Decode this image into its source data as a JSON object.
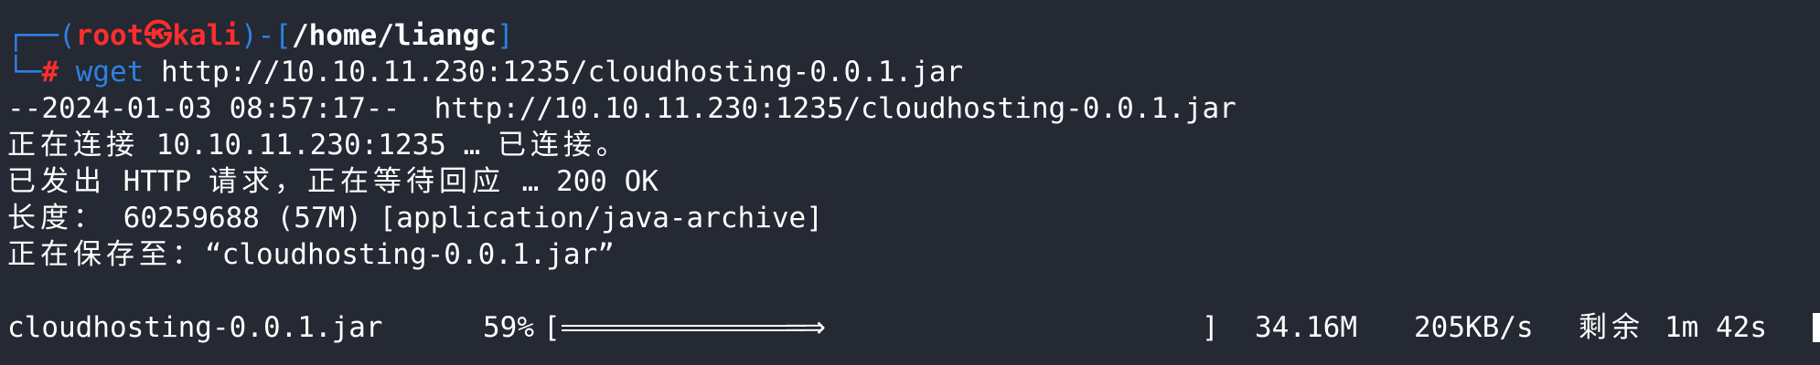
{
  "prompt": {
    "corner_top": "┌──(",
    "user": "root",
    "skull_glyph": "㉿",
    "host": "kali",
    "close_open": ")-[",
    "path": "/home/liangc",
    "close_bracket": "]",
    "corner_bottom": "└─",
    "hash": "#"
  },
  "command": {
    "name": "wget",
    "argument": "http://10.10.11.230:1235/cloudhosting-0.0.1.jar"
  },
  "output": {
    "line1": "--2024-01-03 08:57:17--  http://10.10.11.230:1235/cloudhosting-0.0.1.jar",
    "line2_cjk": "正在连接",
    "line2_rest": " 10.10.11.230:1235 … ",
    "line2_cjk2": "已连接。",
    "line3_cjk": "已发出",
    "line3_mid": " HTTP ",
    "line3_cjk2": "请求，正在等待回应",
    "line3_rest": " … 200 OK",
    "line4_cjk": "长度：",
    "line4_rest": " 60259688 (57M) [application/java-archive]",
    "line5_cjk": "正在保存至：",
    "line5_rest": "“cloudhosting-0.0.1.jar”"
  },
  "progress": {
    "filename": "cloudhosting-0.0.1.jar",
    "percent_text": "59%",
    "fraction": 0.59,
    "open_bracket": "[",
    "arrow": "⟹",
    "close_bracket": "]",
    "downloaded": "34.16M",
    "speed": "205KB/s",
    "eta_label": "剩余",
    "eta": "1m 42s"
  },
  "colors": {
    "background": "#242933",
    "prompt_blue": "#2f80e3",
    "prompt_red": "#ff2e2e",
    "text": "#ffffff"
  }
}
